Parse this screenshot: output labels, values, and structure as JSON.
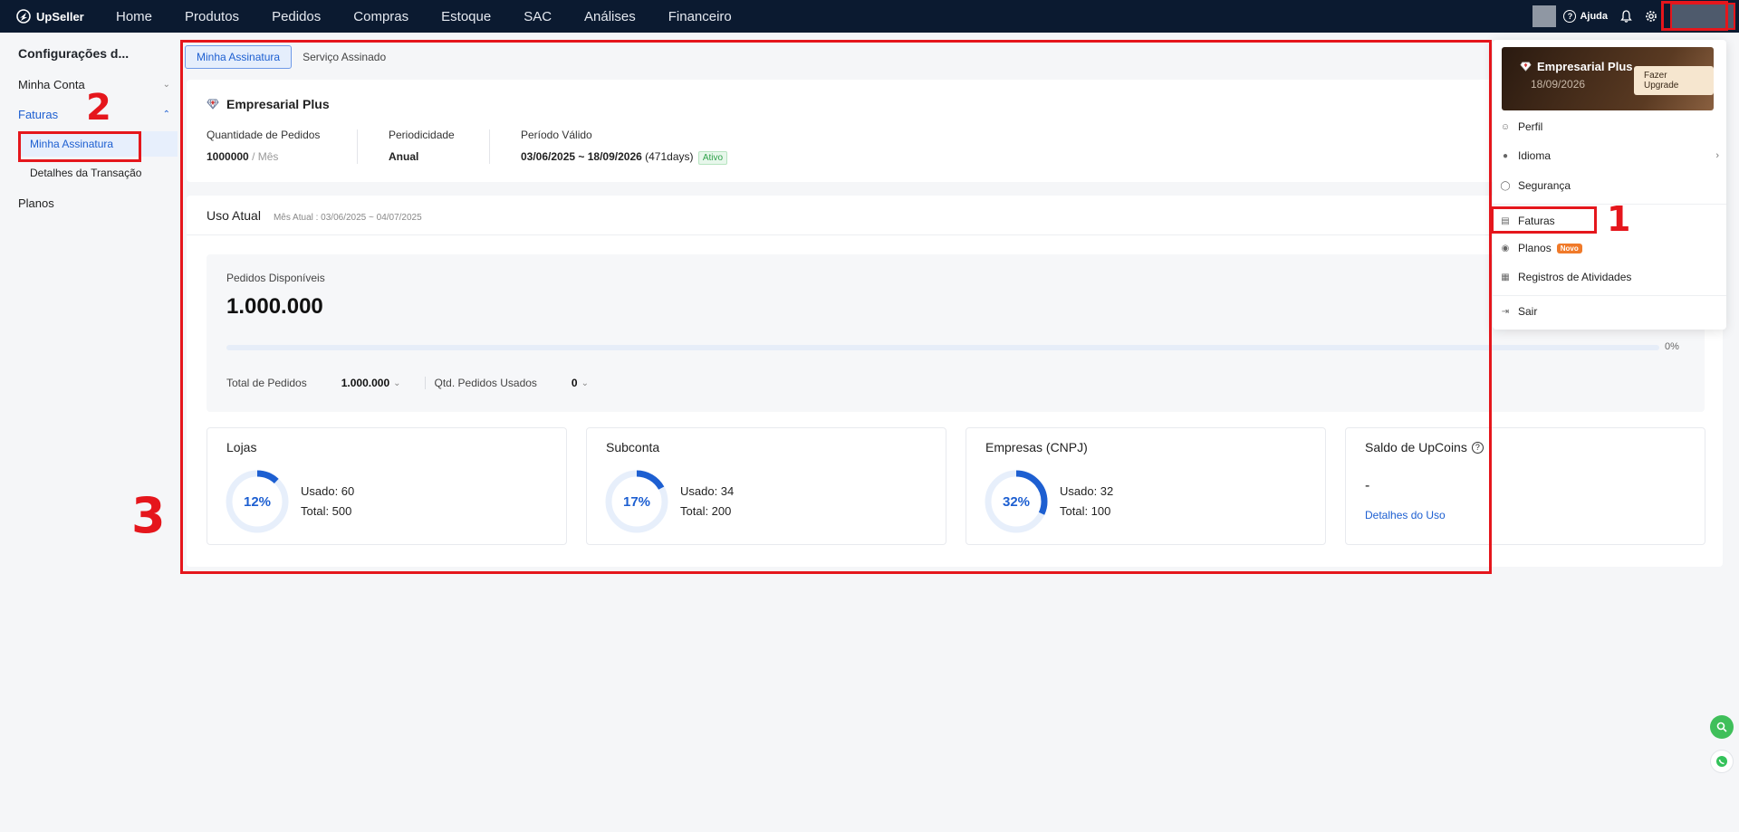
{
  "brand": {
    "name": "UpSeller"
  },
  "nav": {
    "items": [
      "Home",
      "Produtos",
      "Pedidos",
      "Compras",
      "Estoque",
      "SAC",
      "Análises",
      "Financeiro"
    ],
    "help_label": "Ajuda"
  },
  "sidebar": {
    "title": "Configurações d...",
    "items": [
      {
        "label": "Minha Conta"
      },
      {
        "label": "Faturas"
      },
      {
        "label": "Planos"
      }
    ],
    "subitems": [
      "Minha Assinatura",
      "Detalhes da Transação"
    ]
  },
  "tabs": [
    "Minha Assinatura",
    "Serviço Assinado"
  ],
  "plan": {
    "name": "Empresarial Plus",
    "orders_label": "Quantidade de Pedidos",
    "orders_value": "1000000",
    "orders_unit": "/ Mês",
    "period_label": "Periodicidade",
    "period_value": "Anual",
    "valid_label": "Período Válido",
    "valid_value": "03/06/2025 ~ 18/09/2026",
    "valid_days": "(471days)",
    "status": "Ativo"
  },
  "usage": {
    "title": "Uso Atual",
    "month": "Mês Atual : 03/06/2025 ~ 04/07/2025",
    "available_label": "Pedidos Disponíveis",
    "available_value": "1.000.000",
    "progress_percent": 0,
    "progress_text": "0%",
    "total_label": "Total de Pedidos",
    "total_value": "1.000.000",
    "used_label": "Qtd. Pedidos Usados",
    "used_value": "0"
  },
  "stats": [
    {
      "title": "Lojas",
      "percent": 12,
      "percent_text": "12%",
      "used": "Usado: 60",
      "total": "Total: 500"
    },
    {
      "title": "Subconta",
      "percent": 17,
      "percent_text": "17%",
      "used": "Usado: 34",
      "total": "Total: 200"
    },
    {
      "title": "Empresas (CNPJ)",
      "percent": 32,
      "percent_text": "32%",
      "used": "Usado: 32",
      "total": "Total: 100"
    }
  ],
  "upcoins": {
    "title": "Saldo de UpCoins",
    "value": "-",
    "link": "Detalhes do Uso"
  },
  "dropdown": {
    "plan": "Empresarial Plus",
    "date": "18/09/2026",
    "upgrade": "Fazer Upgrade",
    "items": [
      "Perfil",
      "Idioma",
      "Segurança",
      "Faturas",
      "Planos",
      "Registros de Atividades",
      "Sair"
    ],
    "new_badge": "Novo"
  },
  "annotations": {
    "one": "1",
    "two": "2",
    "three": "3"
  },
  "colors": {
    "accent": "#1d5fd1",
    "annotation": "#e5161c",
    "nav_bg": "#0b1a30"
  }
}
